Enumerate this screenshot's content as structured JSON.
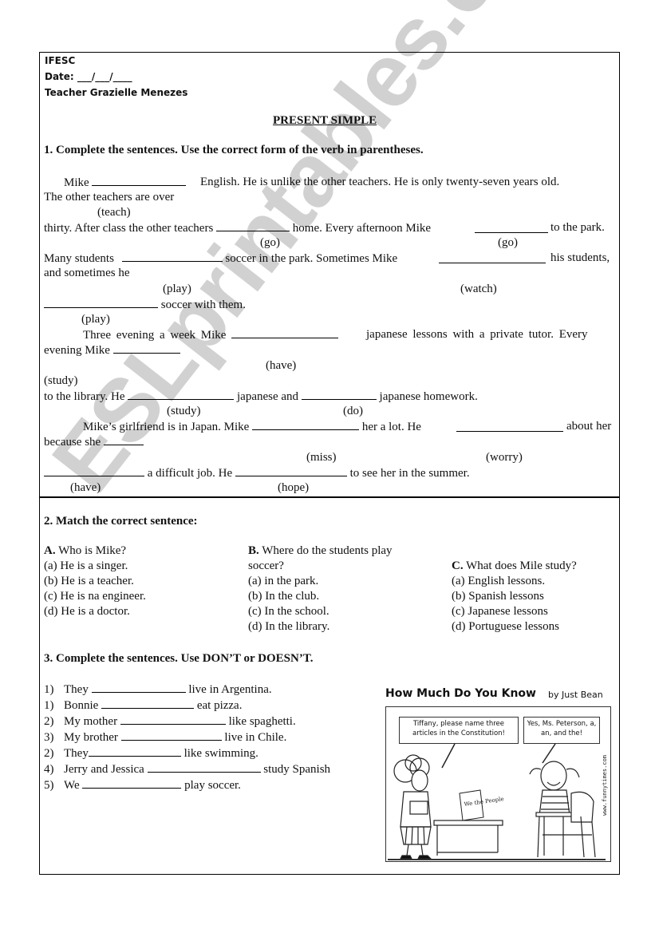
{
  "header": {
    "school": "IFESC",
    "date_label": "Date: ___/___/____",
    "teacher": "Teacher Grazielle Menezes"
  },
  "title": "PRESENT SIMPLE",
  "section1": {
    "heading": "1.   Complete the sentences. Use the correct form of the verb in parentheses.",
    "lines": {
      "l1a": "Mike",
      "l1b": "English. He is unlike the other teachers. He is only twenty-seven years old.",
      "l2": "The other teachers are over",
      "h_teach": "(teach)",
      "l3a": "thirty. After class the other teachers",
      "l3b": "home. Every afternoon Mike",
      "l3c": "to the park.",
      "h_go1": "(go)",
      "h_go2": "(go)",
      "l4a": "Many students",
      "l4b": "soccer in the park. Sometimes Mike",
      "l4c": "his students,",
      "l5": "and sometimes he",
      "h_play1": "(play)",
      "h_watch": "(watch)",
      "l6": "soccer with them.",
      "h_play2": "(play)",
      "l7a": "Three evening a week Mike",
      "l7b": "japanese lessons with a private tutor. Every",
      "l8": "evening Mike",
      "h_have1": "(have)",
      "h_study1": "(study)",
      "l9a": "to the library. He",
      "l9b": "japanese and",
      "l9c": "japanese homework.",
      "h_study2": "(study)",
      "h_do": "(do)",
      "l10a": "Mike’s girlfriend is in Japan. Mike",
      "l10b": "her a lot. He",
      "l10c": "about her",
      "l11": "because she",
      "h_miss": "(miss)",
      "h_worry": "(worry)",
      "l12a": "a difficult job. He",
      "l12b": "to see her in the summer.",
      "h_have2": "(have)",
      "h_hope": "(hope)"
    }
  },
  "section2": {
    "heading": "2. Match the correct sentence:",
    "questions": [
      {
        "letter": "A.",
        "question": "Who is Mike?",
        "options": [
          "(a)  He is a singer.",
          "(b)  He is a teacher.",
          "(c)  He is na engineer.",
          "(d)  He is a doctor."
        ]
      },
      {
        "letter": "B.",
        "question": "Where do the students play",
        "question_cont": "soccer?",
        "options": [
          "(a)  in the park.",
          "(b)  In the club.",
          "(c)  In the school.",
          "(d)  In the library."
        ]
      },
      {
        "letter": "C.",
        "question": "What does Mile study?",
        "options": [
          "(a)  English lessons.",
          "(b)  Spanish lessons",
          "(c)  Japanese lessons",
          "(d)  Portuguese lessons"
        ]
      }
    ]
  },
  "section3": {
    "heading": "3. Complete the sentences. Use DON’T or DOESN’T.",
    "items": [
      {
        "num": "1)",
        "before": "They",
        "after": "live in Argentina."
      },
      {
        "num": "1)",
        "before": "Bonnie",
        "after": "eat pizza."
      },
      {
        "num": "2)",
        "before": "My mother",
        "after": "like spaghetti."
      },
      {
        "num": "3)",
        "before": "My brother",
        "after": "live in Chile."
      },
      {
        "num": "2)",
        "before": "They",
        "after": "like swimming."
      },
      {
        "num": "4)",
        "before": "Jerry and Jessica",
        "after": "study Spanish"
      },
      {
        "num": "5)",
        "before": "We",
        "after": "play soccer."
      }
    ]
  },
  "comic": {
    "title": "How Much Do You Know",
    "byline": "by  Just Bean",
    "bubble_teacher": "Tiffany, please name three articles in the Constitution!",
    "bubble_student": "Yes, Ms. Peterson, a, an, and the!",
    "scroll_text": "We the People",
    "credit": "www.funnytimes.com"
  },
  "watermark": "ESLprintables.com"
}
